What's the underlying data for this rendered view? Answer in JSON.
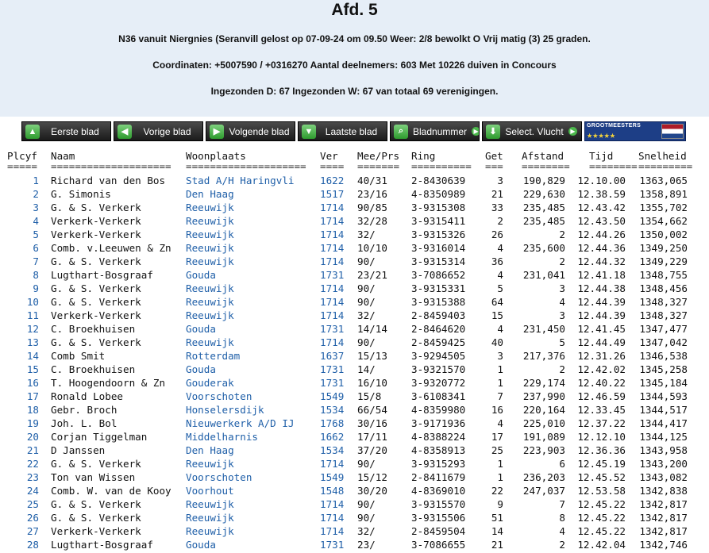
{
  "header": {
    "title": "Afd. 5",
    "line1": "N36 vanuit Niergnies (Seranvill gelost op 07-09-24 om 09.50 Weer: 2/8 bewolkt O Vrij matig (3) 25 graden.",
    "line2": "Coordinaten: +5007590 / +0316270 Aantal deelnemers: 603 Met 10226 duiven in Concours",
    "line3": "Ingezonden D: 67 Ingezonden W: 67 van totaal 69 verenigingen."
  },
  "toolbar": {
    "first": "Eerste blad",
    "prev": "Vorige blad",
    "next": "Volgende blad",
    "last": "Laatste blad",
    "page": "Bladnummer",
    "flight": "Select. Vlucht",
    "logo_text": "GROOTMEESTERS",
    "logo_stars": "★★★★★"
  },
  "colors": {
    "link": "#1f5fa8",
    "header_bg": "#e6eef7",
    "button_bg": "#2a2a2a"
  },
  "columns": {
    "plcyf": "Plcyf",
    "naam": "Naam",
    "woonplaats": "Woonplaats",
    "ver": "Ver",
    "meeprs": "Mee/Prs",
    "ring": "Ring",
    "get": "Get",
    "afstand": "Afstand",
    "tijd": "Tijd",
    "snelheid": "Snelheid"
  },
  "separators": {
    "plcyf": "=====",
    "naam": "====================",
    "woonplaats": "====================",
    "ver": "====",
    "meeprs": "=======",
    "ring": "==========",
    "get": "===",
    "afstand": "========",
    "tijd": "========",
    "snelheid": "========="
  },
  "rows": [
    [
      "1",
      "Richard van den Bos",
      "Stad A/H Haringvli",
      "1622",
      "40/31",
      "2-8430639",
      "3",
      "190,829",
      "12.10.00",
      "1363,065"
    ],
    [
      "2",
      "G. Simonis",
      "Den Haag",
      "1517",
      "23/16",
      "4-8350989",
      "21",
      "229,630",
      "12.38.59",
      "1358,891"
    ],
    [
      "3",
      "G. & S. Verkerk",
      "Reeuwijk",
      "1714",
      "90/85",
      "3-9315308",
      "33",
      "235,485",
      "12.43.42",
      "1355,702"
    ],
    [
      "4",
      "Verkerk-Verkerk",
      "Reeuwijk",
      "1714",
      "32/28",
      "3-9315411",
      "2",
      "235,485",
      "12.43.50",
      "1354,662"
    ],
    [
      "5",
      "Verkerk-Verkerk",
      "Reeuwijk",
      "1714",
      "32/",
      "3-9315326",
      "26",
      "2",
      "12.44.26",
      "1350,002"
    ],
    [
      "6",
      "Comb. v.Leeuwen & Zn",
      "Reeuwijk",
      "1714",
      "10/10",
      "3-9316014",
      "4",
      "235,600",
      "12.44.36",
      "1349,250"
    ],
    [
      "7",
      "G. & S. Verkerk",
      "Reeuwijk",
      "1714",
      "90/",
      "3-9315314",
      "36",
      "2",
      "12.44.32",
      "1349,229"
    ],
    [
      "8",
      "Lugthart-Bosgraaf",
      "Gouda",
      "1731",
      "23/21",
      "3-7086652",
      "4",
      "231,041",
      "12.41.18",
      "1348,755"
    ],
    [
      "9",
      "G. & S. Verkerk",
      "Reeuwijk",
      "1714",
      "90/",
      "3-9315331",
      "5",
      "3",
      "12.44.38",
      "1348,456"
    ],
    [
      "10",
      "G. & S. Verkerk",
      "Reeuwijk",
      "1714",
      "90/",
      "3-9315388",
      "64",
      "4",
      "12.44.39",
      "1348,327"
    ],
    [
      "11",
      "Verkerk-Verkerk",
      "Reeuwijk",
      "1714",
      "32/",
      "2-8459403",
      "15",
      "3",
      "12.44.39",
      "1348,327"
    ],
    [
      "12",
      "C. Broekhuisen",
      "Gouda",
      "1731",
      "14/14",
      "2-8464620",
      "4",
      "231,450",
      "12.41.45",
      "1347,477"
    ],
    [
      "13",
      "G. & S. Verkerk",
      "Reeuwijk",
      "1714",
      "90/",
      "2-8459425",
      "40",
      "5",
      "12.44.49",
      "1347,042"
    ],
    [
      "14",
      "Comb Smit",
      "Rotterdam",
      "1637",
      "15/13",
      "3-9294505",
      "3",
      "217,376",
      "12.31.26",
      "1346,538"
    ],
    [
      "15",
      "C. Broekhuisen",
      "Gouda",
      "1731",
      "14/",
      "3-9321570",
      "1",
      "2",
      "12.42.02",
      "1345,258"
    ],
    [
      "16",
      "T. Hoogendoorn & Zn",
      "Gouderak",
      "1731",
      "16/10",
      "3-9320772",
      "1",
      "229,174",
      "12.40.22",
      "1345,184"
    ],
    [
      "17",
      "Ronald Lobee",
      "Voorschoten",
      "1549",
      "15/8",
      "3-6108341",
      "7",
      "237,990",
      "12.46.59",
      "1344,593"
    ],
    [
      "18",
      "Gebr. Broch",
      "Honselersdijk",
      "1534",
      "66/54",
      "4-8359980",
      "16",
      "220,164",
      "12.33.45",
      "1344,517"
    ],
    [
      "19",
      "Joh. L. Bol",
      "Nieuwerkerk A/D IJ",
      "1768",
      "30/16",
      "3-9171936",
      "4",
      "225,010",
      "12.37.22",
      "1344,417"
    ],
    [
      "20",
      "Corjan Tiggelman",
      "Middelharnis",
      "1662",
      "17/11",
      "4-8388224",
      "17",
      "191,089",
      "12.12.10",
      "1344,125"
    ],
    [
      "21",
      "D Janssen",
      "Den Haag",
      "1534",
      "37/20",
      "4-8358913",
      "25",
      "223,903",
      "12.36.36",
      "1343,958"
    ],
    [
      "22",
      "G. & S. Verkerk",
      "Reeuwijk",
      "1714",
      "90/",
      "3-9315293",
      "1",
      "6",
      "12.45.19",
      "1343,200"
    ],
    [
      "23",
      "Ton van Wissen",
      "Voorschoten",
      "1549",
      "15/12",
      "2-8411679",
      "1",
      "236,203",
      "12.45.52",
      "1343,082"
    ],
    [
      "24",
      "Comb. W. van de Kooy",
      "Voorhout",
      "1548",
      "30/20",
      "4-8369010",
      "22",
      "247,037",
      "12.53.58",
      "1342,838"
    ],
    [
      "25",
      "G. & S. Verkerk",
      "Reeuwijk",
      "1714",
      "90/",
      "3-9315570",
      "9",
      "7",
      "12.45.22",
      "1342,817"
    ],
    [
      "26",
      "G. & S. Verkerk",
      "Reeuwijk",
      "1714",
      "90/",
      "3-9315506",
      "51",
      "8",
      "12.45.22",
      "1342,817"
    ],
    [
      "27",
      "Verkerk-Verkerk",
      "Reeuwijk",
      "1714",
      "32/",
      "2-8459504",
      "14",
      "4",
      "12.45.22",
      "1342,817"
    ],
    [
      "28",
      "Lugthart-Bosgraaf",
      "Gouda",
      "1731",
      "23/",
      "3-7086655",
      "21",
      "2",
      "12.42.04",
      "1342,746"
    ]
  ]
}
